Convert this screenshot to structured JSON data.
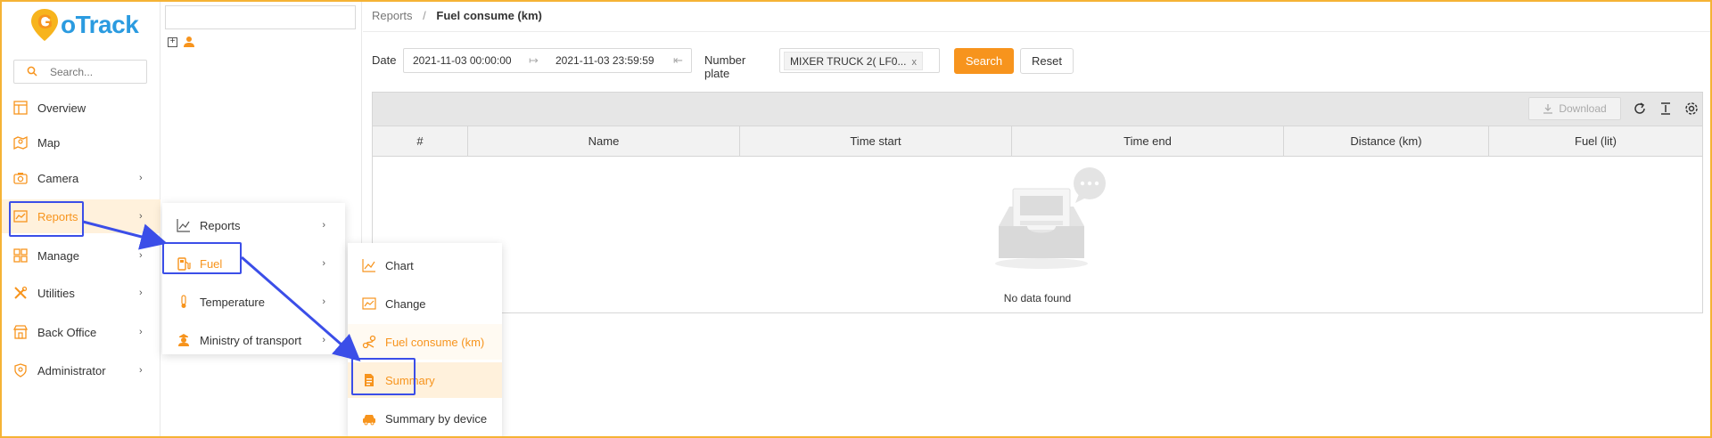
{
  "app": {
    "logo_text_first": "G",
    "logo_text_rest": "oTrack",
    "brand_color": "#f7941d",
    "logo_blue": "#2b9be0"
  },
  "sidebar": {
    "search_placeholder": "Search...",
    "items": [
      {
        "label": "Overview",
        "icon": "layout-icon",
        "has_submenu": false
      },
      {
        "label": "Map",
        "icon": "map-icon",
        "has_submenu": false
      },
      {
        "label": "Camera",
        "icon": "camera-icon",
        "has_submenu": true
      },
      {
        "label": "Reports",
        "icon": "chart-icon",
        "has_submenu": true,
        "active": true
      },
      {
        "label": "Manage",
        "icon": "grid-icon",
        "has_submenu": true
      },
      {
        "label": "Utilities",
        "icon": "tools-icon",
        "has_submenu": true
      },
      {
        "label": "Back Office",
        "icon": "store-icon",
        "has_submenu": true
      },
      {
        "label": "Administrator",
        "icon": "shield-icon",
        "has_submenu": true
      }
    ]
  },
  "breadcrumb": {
    "parent": "Reports",
    "separator": "/",
    "current": "Fuel consume (km)"
  },
  "filter": {
    "date_label": "Date",
    "date_start": "2021-11-03 00:00:00",
    "date_end": "2021-11-03 23:59:59",
    "plate_label": "Number plate",
    "plate_value": "MIXER TRUCK 2( LF0...",
    "plate_remove": "x",
    "search_label": "Search",
    "reset_label": "Reset"
  },
  "toolbar": {
    "download_label": "Download"
  },
  "table": {
    "columns": [
      "#",
      "Name",
      "Time start",
      "Time end",
      "Distance (km)",
      "Fuel (lit)"
    ],
    "empty_text": "No data found"
  },
  "menu_reports": {
    "items": [
      {
        "label": "Reports",
        "icon": "line-chart-icon"
      },
      {
        "label": "Fuel",
        "icon": "fuel-pump-icon",
        "active": true
      },
      {
        "label": "Temperature",
        "icon": "thermometer-icon"
      },
      {
        "label": "Ministry of transport",
        "icon": "officer-icon"
      }
    ]
  },
  "menu_fuel": {
    "items": [
      {
        "label": "Chart",
        "icon": "line-chart-icon"
      },
      {
        "label": "Change",
        "icon": "area-chart-icon"
      },
      {
        "label": "Fuel consume (km)",
        "icon": "route-icon",
        "current": true
      },
      {
        "label": "Summary",
        "icon": "document-icon",
        "highlighted": true
      },
      {
        "label": "Summary by device",
        "icon": "car-icon"
      }
    ]
  }
}
